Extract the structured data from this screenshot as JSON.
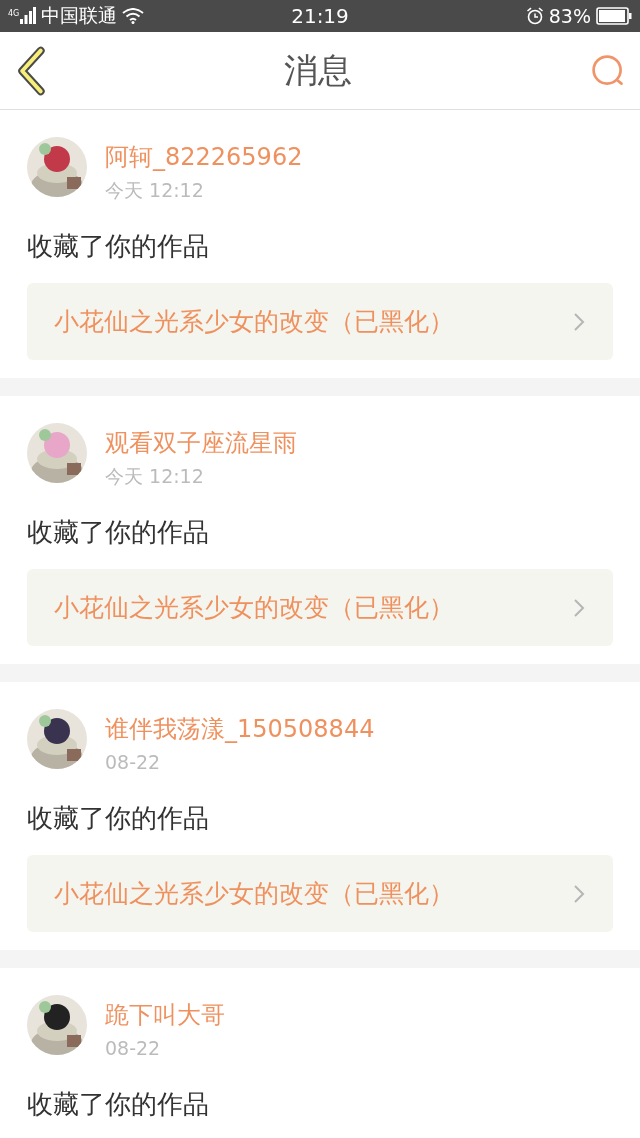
{
  "status_bar": {
    "network": "4G",
    "carrier": "中国联通",
    "time": "21:19",
    "battery": "83%"
  },
  "header": {
    "title": "消息"
  },
  "messages": [
    {
      "user": "阿轲_822265962",
      "time": "今天 12:12",
      "action": "收藏了你的作品",
      "work": "小花仙之光系少女的改变（已黑化）"
    },
    {
      "user": "观看双子座流星雨",
      "time": "今天 12:12",
      "action": "收藏了你的作品",
      "work": "小花仙之光系少女的改变（已黑化）"
    },
    {
      "user": "谁伴我荡漾_150508844",
      "time": "08-22",
      "action": "收藏了你的作品",
      "work": "小花仙之光系少女的改变（已黑化）"
    },
    {
      "user": "跪下叫大哥",
      "time": "08-22",
      "action": "收藏了你的作品"
    }
  ]
}
